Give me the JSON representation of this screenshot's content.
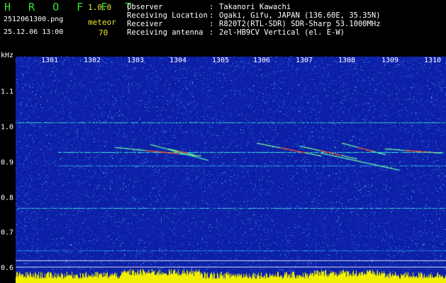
{
  "header": {
    "app_title": "H R O F F T",
    "version": "1.0.0",
    "file_name": "2512061300.png",
    "date_time": "25.12.06 13:00",
    "meteor_label": "meteor",
    "meteor_count": "70"
  },
  "info": [
    {
      "label": "Observer",
      "sep": ":",
      "value": "Takanori Kawachi"
    },
    {
      "label": "Receiving Location",
      "sep": ":",
      "value": "Ogaki, Gifu, JAPAN (136.60E, 35.35N)"
    },
    {
      "label": "Receiver",
      "sep": ":",
      "value": "R820T2(RTL-SDR) SDR-Sharp 53.1000MHz"
    },
    {
      "label": "Receiving antenna",
      "sep": ":",
      "value": "2el-HB9CV Vertical (el. E-W)"
    }
  ],
  "axis": {
    "unit_label": "kHz",
    "time_labels": [
      "1301",
      "1302",
      "1303",
      "1304",
      "1305",
      "1306",
      "1307",
      "1308",
      "1309",
      "1310"
    ],
    "freq_labels": [
      "1.1",
      "1.0",
      "0.9",
      "0.8",
      "0.7",
      "0.6"
    ]
  },
  "colors": {
    "background": "#000000",
    "spectrogram_bg": "#0c1fa6",
    "title_green": "#38e038",
    "accent_yellow": "#e8e828",
    "carrier_cyan": "#40e8e0"
  }
}
